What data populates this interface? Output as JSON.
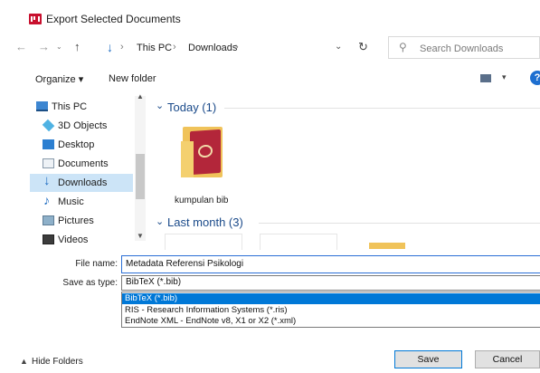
{
  "window": {
    "title": "Export Selected Documents"
  },
  "address": {
    "crumbs": [
      "This PC",
      "Downloads"
    ],
    "search_placeholder": "Search Downloads"
  },
  "commandbar": {
    "organize": "Organize ▾",
    "new_folder": "New folder"
  },
  "nav_items": [
    {
      "label": "This PC",
      "icon": "pc-icon"
    },
    {
      "label": "3D Objects",
      "icon": "3d-objects-icon"
    },
    {
      "label": "Desktop",
      "icon": "desktop-icon"
    },
    {
      "label": "Documents",
      "icon": "documents-icon"
    },
    {
      "label": "Downloads",
      "icon": "downloads-icon",
      "selected": true
    },
    {
      "label": "Music",
      "icon": "music-icon"
    },
    {
      "label": "Pictures",
      "icon": "pictures-icon"
    },
    {
      "label": "Videos",
      "icon": "videos-icon"
    }
  ],
  "groups": [
    {
      "header": "Today (1)"
    },
    {
      "header": "Last month (3)"
    }
  ],
  "files": [
    {
      "name": "kumpulan bib",
      "icon": "bib-folder-icon"
    }
  ],
  "form": {
    "file_name_label": "File name:",
    "file_name_value": "Metadata Referensi Psikologi",
    "save_type_label": "Save as type:",
    "save_type_value": "BibTeX (*.bib)",
    "save_type_options": [
      "BibTeX (*.bib)",
      "RIS - Research Information Systems (*.ris)",
      "EndNote XML - EndNote v8, X1 or X2 (*.xml)"
    ],
    "selected_option_index": 0
  },
  "footer": {
    "hide_folders": "Hide Folders",
    "save": "Save",
    "cancel": "Cancel"
  },
  "colors": {
    "accent": "#0078d7",
    "selection": "#cce4f7",
    "folder": "#f0c35a",
    "app_red": "#c8102e"
  }
}
